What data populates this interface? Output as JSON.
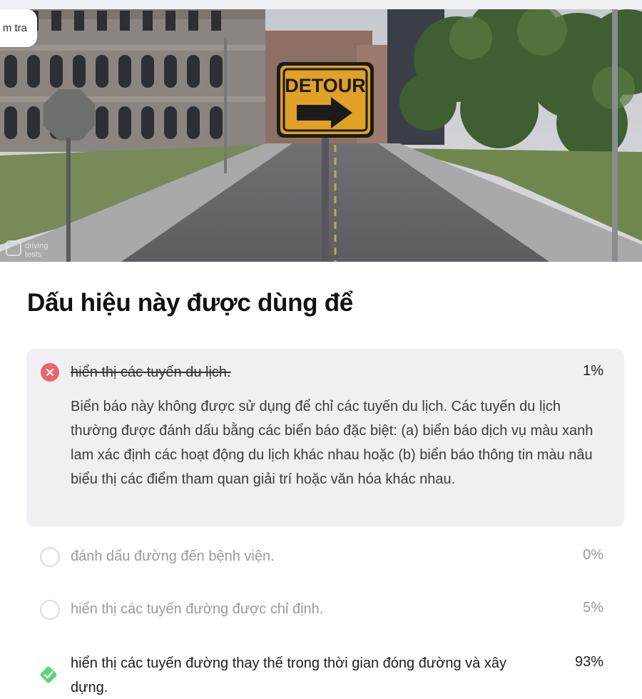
{
  "header": {
    "tag_label": "m tra"
  },
  "scene": {
    "sign_text": "DETOUR",
    "watermark_line1": "driving",
    "watermark_line2": "tests"
  },
  "question": {
    "title": "Dấu hiệu này được dùng để"
  },
  "answers": [
    {
      "label": "hiển thị các tuyến du lịch.",
      "percent": "1%",
      "state": "wrong",
      "explanation": "Biển báo này không được sử dụng để chỉ các tuyến du lịch. Các tuyến du lịch thường được đánh dấu bằng các biển báo đặc biệt: (a) biển báo dịch vụ màu xanh lam xác định các hoạt động du lịch khác nhau hoặc (b) biển báo thông tin màu nâu biểu thị các điểm tham quan giải trí hoặc văn hóa khác nhau."
    },
    {
      "label": "đánh dấu đường đến bệnh viện.",
      "percent": "0%",
      "state": "unselected"
    },
    {
      "label": "hiển thị các tuyến đường được chỉ định.",
      "percent": "5%",
      "state": "unselected"
    },
    {
      "label": "hiển thị các tuyến đường thay thế trong thời gian đóng đường và xây dựng.",
      "percent": "93%",
      "state": "correct"
    }
  ],
  "colors": {
    "wrong": "#e9646e",
    "correct": "#5fd37a",
    "sign": "#e0a125",
    "selected_bg": "#f0f0f4"
  },
  "icons": {
    "wrong": "x-circle-icon",
    "correct": "check-diamond-icon",
    "unselected": "empty-radio-icon"
  }
}
